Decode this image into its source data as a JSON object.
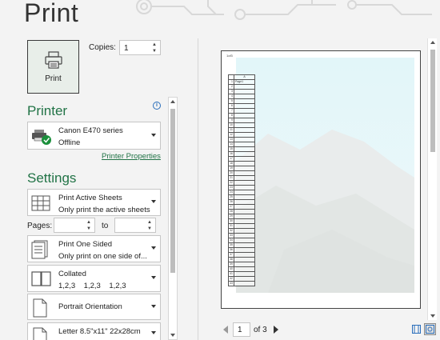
{
  "header": {
    "title": "Print"
  },
  "print_button": {
    "label": "Print"
  },
  "copies": {
    "label": "Copies:",
    "value": "1"
  },
  "printer": {
    "section_title": "Printer",
    "name": "Canon E470 series",
    "status": "Offline",
    "properties_link": "Printer Properties"
  },
  "settings": {
    "section_title": "Settings",
    "scope": {
      "title": "Print Active Sheets",
      "subtitle": "Only print the active sheets"
    },
    "pages": {
      "label": "Pages:",
      "to_label": "to",
      "from_value": "",
      "to_value": ""
    },
    "sides": {
      "title": "Print One Sided",
      "subtitle": "Only print on one side of..."
    },
    "collation": {
      "title": "Collated",
      "subtitle": "1,2,3    1,2,3    1,2,3"
    },
    "orientation": {
      "title": "Portrait Orientation"
    },
    "paper": {
      "title": "Letter 8.5\"x11\" 22x28cm"
    }
  },
  "preview": {
    "page_header": "1of3",
    "column_header": "A",
    "first_cell": "Page1",
    "row_count": 43,
    "current_page": "1",
    "total_pages": "of 3"
  },
  "colors": {
    "accent": "#217346",
    "print_button_bg": "#e8eee9",
    "panel_bg": "#f3f3f3"
  },
  "icons": [
    "printer-icon",
    "printer-status-icon",
    "info-icon",
    "sheets-icon",
    "one-sided-icon",
    "collated-icon",
    "portrait-icon",
    "letter-icon",
    "show-margins-icon",
    "zoom-to-page-icon"
  ]
}
